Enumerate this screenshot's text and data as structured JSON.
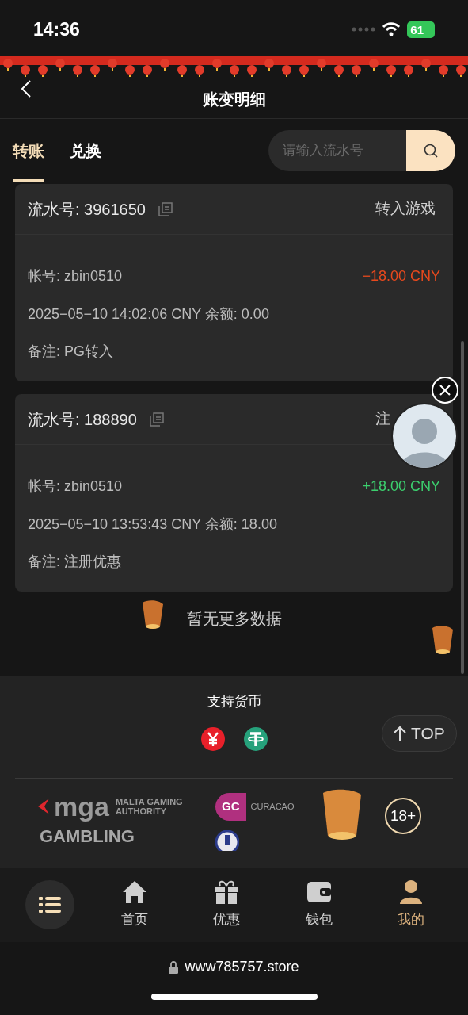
{
  "status_bar": {
    "time": "14:36",
    "battery": "61"
  },
  "header": {
    "title": "账变明细"
  },
  "tabs": [
    {
      "label": "转账",
      "selected": true
    },
    {
      "label": "兑换",
      "selected": false
    }
  ],
  "search": {
    "placeholder": "请输入流水号"
  },
  "entries": [
    {
      "serial": "流水号: 3961650",
      "type": "转入游戏",
      "account": "帐号: zbin0510",
      "amount": "−18.00 CNY",
      "kind": "debit",
      "time_balance": "2025−05−10 14:02:06 CNY 余额: 0.00",
      "note": "备注: PG转入"
    },
    {
      "serial": "流水号: 188890",
      "type": "注",
      "account": "帐号: zbin0510",
      "amount": "+18.00 CNY",
      "kind": "credit",
      "time_balance": "2025−05−10 13:53:43 CNY 余额: 18.00",
      "note": "备注: 注册优惠"
    }
  ],
  "end_message": "暂无更多数据",
  "footer": {
    "currency_title": "支持货币",
    "top_button": "TOP",
    "logos": {
      "mga": "mga",
      "mga_caption": "MALTA GAMING AUTHORITY",
      "gc": "GC",
      "gc_caption": "CURACAO",
      "gambling": "GAMBLING",
      "age": "18+"
    }
  },
  "bottom_nav": [
    {
      "label": "首页",
      "selected": false
    },
    {
      "label": "优惠",
      "selected": false
    },
    {
      "label": "钱包",
      "selected": false
    },
    {
      "label": "我的",
      "selected": true
    }
  ],
  "browser": {
    "url": "www785757.store"
  }
}
